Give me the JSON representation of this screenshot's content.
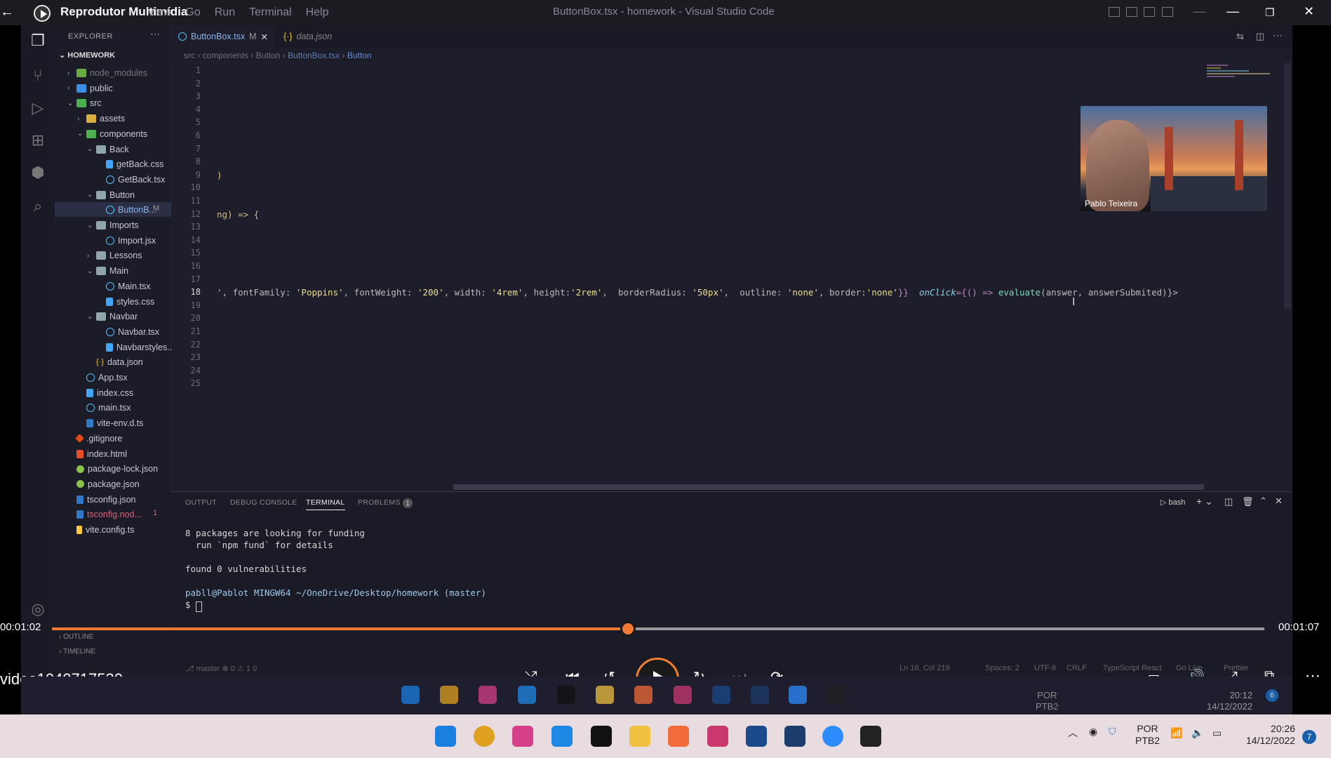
{
  "player": {
    "app_title": "Reprodutor Multimídia",
    "video_name": "video1040717530",
    "time_current": "00:01:02",
    "time_total": "00:01:07",
    "progress_fraction": 0.475
  },
  "window": {
    "title": "ButtonBox.tsx - homework - Visual Studio Code",
    "menu": [
      "View",
      "Go",
      "Run",
      "Terminal",
      "Help"
    ]
  },
  "explorer": {
    "header": "EXPLORER",
    "root": "HOMEWORK",
    "items": [
      {
        "label": "node_modules",
        "indent": 0,
        "kind": "folder node",
        "chev": "›",
        "dim": true
      },
      {
        "label": "public",
        "indent": 0,
        "kind": "folder pub",
        "chev": "›"
      },
      {
        "label": "src",
        "indent": 0,
        "kind": "folder src",
        "chev": "⌄",
        "open": true
      },
      {
        "label": "assets",
        "indent": 1,
        "kind": "folder",
        "chev": "›"
      },
      {
        "label": "components",
        "indent": 1,
        "kind": "folder src",
        "chev": "⌄"
      },
      {
        "label": "Back",
        "indent": 2,
        "kind": "folder plain",
        "chev": "⌄"
      },
      {
        "label": "getBack.css",
        "indent": 3,
        "kind": "css"
      },
      {
        "label": "GetBack.tsx",
        "indent": 3,
        "kind": "react"
      },
      {
        "label": "Button",
        "indent": 2,
        "kind": "folder plain",
        "chev": "⌄"
      },
      {
        "label": "ButtonB...",
        "indent": 3,
        "kind": "react",
        "badge": "M",
        "selected": true
      },
      {
        "label": "Imports",
        "indent": 2,
        "kind": "folder plain",
        "chev": "⌄"
      },
      {
        "label": "Import.jsx",
        "indent": 3,
        "kind": "react"
      },
      {
        "label": "Lessons",
        "indent": 2,
        "kind": "folder plain",
        "chev": "›"
      },
      {
        "label": "Main",
        "indent": 2,
        "kind": "folder plain",
        "chev": "⌄"
      },
      {
        "label": "Main.tsx",
        "indent": 3,
        "kind": "react"
      },
      {
        "label": "styles.css",
        "indent": 3,
        "kind": "css"
      },
      {
        "label": "Navbar",
        "indent": 2,
        "kind": "folder plain",
        "chev": "⌄"
      },
      {
        "label": "Navbar.tsx",
        "indent": 3,
        "kind": "react"
      },
      {
        "label": "Navbarstyles....",
        "indent": 3,
        "kind": "css"
      },
      {
        "label": "data.json",
        "indent": 2,
        "kind": "json"
      },
      {
        "label": "App.tsx",
        "indent": 1,
        "kind": "react"
      },
      {
        "label": "index.css",
        "indent": 1,
        "kind": "css"
      },
      {
        "label": "main.tsx",
        "indent": 1,
        "kind": "react"
      },
      {
        "label": "vite-env.d.ts",
        "indent": 1,
        "kind": "ts"
      },
      {
        "label": ".gitignore",
        "indent": 0,
        "kind": "git"
      },
      {
        "label": "index.html",
        "indent": 0,
        "kind": "html"
      },
      {
        "label": "package-lock.json",
        "indent": 0,
        "kind": "pkg"
      },
      {
        "label": "package.json",
        "indent": 0,
        "kind": "pkg"
      },
      {
        "label": "tsconfig.json",
        "indent": 0,
        "kind": "ts"
      },
      {
        "label": "tsconfig.nod...",
        "indent": 0,
        "kind": "ts",
        "badge": "1",
        "error": true
      },
      {
        "label": "vite.config.ts",
        "indent": 0,
        "kind": "vite"
      }
    ],
    "outline": "OUTLINE",
    "timeline": "TIMELINE"
  },
  "tabs": [
    {
      "label": "ButtonBox.tsx",
      "badge": "M",
      "active": true
    },
    {
      "label": "data.json",
      "active": false
    }
  ],
  "breadcrumb": [
    "src",
    "components",
    "Button",
    "ButtonBox.tsx",
    "Button"
  ],
  "editor": {
    "line_numbers": [
      "1",
      "2",
      "3",
      "4",
      "5",
      "6",
      "7",
      "8",
      "9",
      "10",
      "11",
      "12",
      "13",
      "14",
      "15",
      "16",
      "17",
      "18",
      "19",
      "20",
      "21",
      "22",
      "23",
      "24",
      "25"
    ],
    "line9": ")",
    "line12": "ng) => {",
    "line18": {
      "a": "', fontFamily: ",
      "b": "'Poppins'",
      "c": ", fontWeight: ",
      "d": "'200'",
      "e": ", width: ",
      "f": "'4rem'",
      "g": ", height:",
      "h": "'2rem'",
      "i": ",  borderRadius: ",
      "j": "'50px'",
      "k": ",  outline: ",
      "l": "'none'",
      "m": ", border:",
      "n": "'none'",
      "o": "}}",
      "p": "  onClick",
      "q": "={() => ",
      "r": "evaluate",
      "s": "(answer, answerSubmited)}>"
    }
  },
  "webcam": {
    "name": "Pablo Teixeira"
  },
  "panel": {
    "tabs": [
      "OUTPUT",
      "DEBUG CONSOLE",
      "TERMINAL",
      "PROBLEMS"
    ],
    "problems_count": "1",
    "shell": "bash",
    "lines": [
      "8 packages are looking for funding",
      "  run `npm fund` for details",
      "",
      "found 0 vulnerabilities",
      "",
      "pabll@Pablot MINGW64 ~/OneDrive/Desktop/homework (master)",
      "$ "
    ]
  },
  "status": {
    "cursor": "Ln 18, Col 219",
    "spaces": "Spaces: 2",
    "encoding": "UTF-8",
    "eol": "CRLF",
    "language": "TypeScript React",
    "golive": "Go Live",
    "prettier": "Prettier",
    "branch": "master",
    "errors": "0",
    "warnings": "1 0"
  },
  "inner_clock": {
    "lang": "POR",
    "layout": "PTB2",
    "time": "20:12",
    "date": "14/12/2022",
    "notif": "6"
  },
  "clock": {
    "lang": "POR",
    "layout": "PTB2",
    "time": "20:26",
    "date": "14/12/2022",
    "notif": "7"
  },
  "colors": {
    "accent": "#f07a32",
    "editor_bg": "#1d1d2b",
    "taskbar_bg": "#e8dce0"
  },
  "taskbar_icons": [
    "windows-start",
    "chrome",
    "instagram",
    "vscode",
    "netflix",
    "file-explorer",
    "postman",
    "git-kraken",
    "prime-video",
    "cmd",
    "zoom",
    "media-player"
  ]
}
